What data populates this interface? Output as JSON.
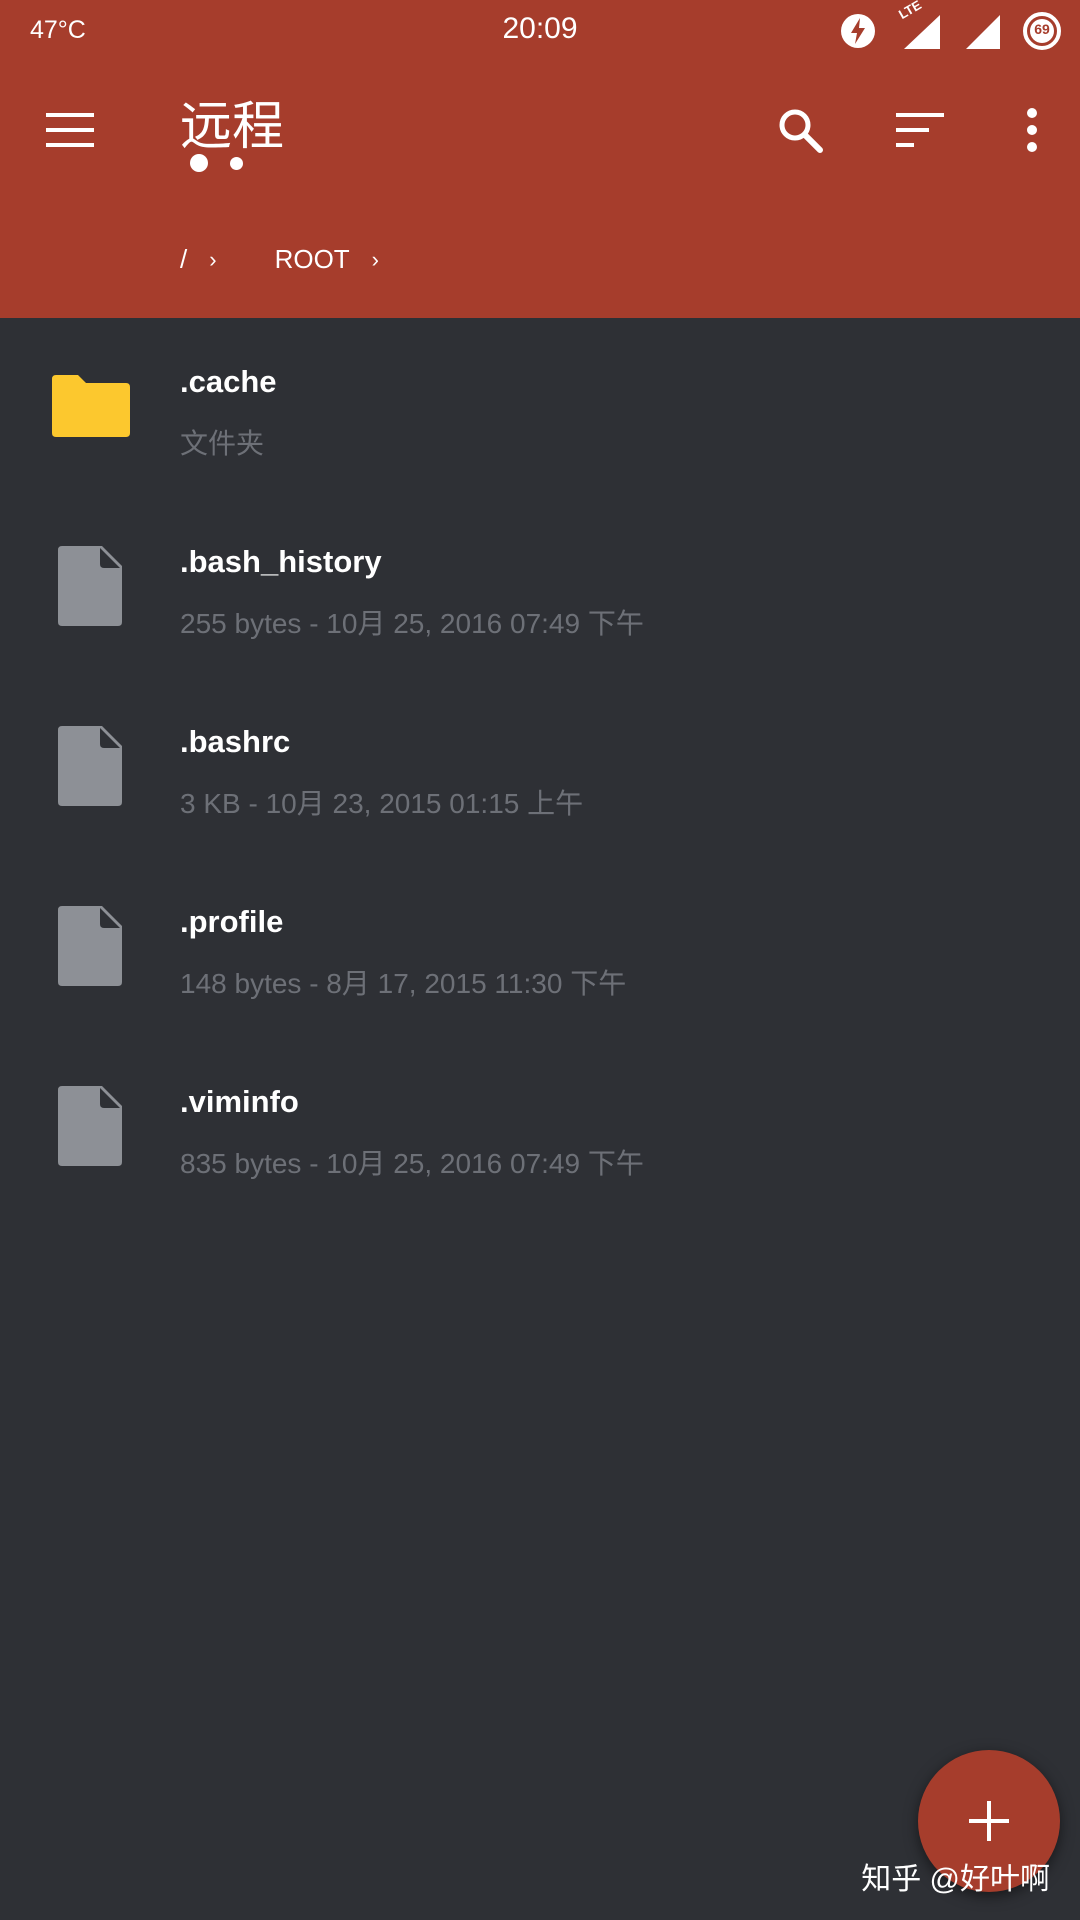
{
  "status_bar": {
    "temperature": "47°C",
    "time": "20:09",
    "network_label": "LTE",
    "battery_level": "69",
    "icons": [
      "flash-icon",
      "signal-lte-icon",
      "signal-icon",
      "battery-icon"
    ]
  },
  "toolbar": {
    "title": "远程",
    "page_dots": 2,
    "active_page": 0,
    "actions": [
      "menu-icon",
      "search-icon",
      "sort-icon",
      "more-vert-icon"
    ]
  },
  "breadcrumb": [
    {
      "label": "/",
      "separator": "›"
    },
    {
      "label": "ROOT",
      "separator": "›"
    }
  ],
  "files": [
    {
      "name": ".cache",
      "meta": "文件夹",
      "type": "folder"
    },
    {
      "name": ".bash_history",
      "meta": "255 bytes  -  10月 25, 2016  07:49 下午",
      "type": "file"
    },
    {
      "name": ".bashrc",
      "meta": "3 KB  -  10月 23, 2015  01:15 上午",
      "type": "file"
    },
    {
      "name": ".profile",
      "meta": "148 bytes  -  8月 17, 2015  11:30 下午",
      "type": "file"
    },
    {
      "name": ".viminfo",
      "meta": "835 bytes  -  10月 25, 2016  07:49 下午",
      "type": "file"
    }
  ],
  "fab": {
    "icon": "add-icon"
  },
  "watermark": "知乎 @好叶啊",
  "colors": {
    "accent": "#a63d2c",
    "background": "#2e3035",
    "folder": "#fcc82e",
    "file_icon": "#8d9096",
    "secondary_text": "#6d7077"
  }
}
